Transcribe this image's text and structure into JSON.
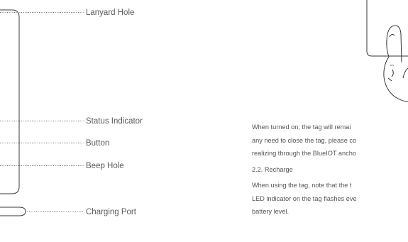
{
  "callouts": {
    "lanyard_hole": "Lanyard Hole",
    "status_indicator": "Status Indicator",
    "button": "Button",
    "beep_hole": "Beep Hole",
    "charging_port": "Charging Port"
  },
  "body_text": {
    "para1_line1": "When turned on, the tag will remai",
    "para1_line2": "any need to close the tag, please co",
    "para1_line3": "realizing through the BlueIOT ancho",
    "section_heading": "2.2. Recharge",
    "para2_line1": "When using the tag, note that the t",
    "para2_line2": "LED indicator on the tag flashes eve",
    "para2_line3": "battery level."
  }
}
